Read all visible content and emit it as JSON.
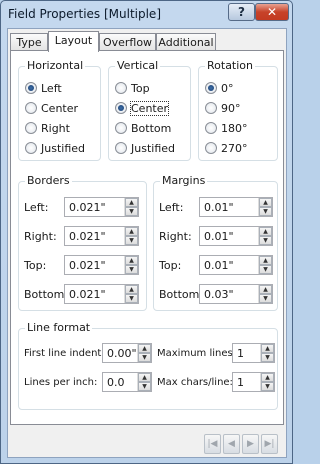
{
  "window": {
    "title": "Field Properties [Multiple]",
    "help_label": "?",
    "close_label": "✕"
  },
  "tabs": [
    {
      "label": "Type"
    },
    {
      "label": "Layout"
    },
    {
      "label": "Overflow"
    },
    {
      "label": "Additional"
    }
  ],
  "active_tab": "Layout",
  "horizontal": {
    "legend": "Horizontal",
    "options": [
      "Left",
      "Center",
      "Right",
      "Justified"
    ],
    "selected": "Left"
  },
  "vertical": {
    "legend": "Vertical",
    "options": [
      "Top",
      "Center",
      "Bottom",
      "Justified"
    ],
    "selected": "Center"
  },
  "rotation": {
    "legend": "Rotation",
    "options": [
      "0°",
      "90°",
      "180°",
      "270°"
    ],
    "selected": "0°"
  },
  "borders": {
    "legend": "Borders",
    "left_label": "Left:",
    "left_value": "0.021\"",
    "right_label": "Right:",
    "right_value": "0.021\"",
    "top_label": "Top:",
    "top_value": "0.021\"",
    "bottom_label": "Bottom:",
    "bottom_value": "0.021\""
  },
  "margins": {
    "legend": "Margins",
    "left_label": "Left:",
    "left_value": "0.01\"",
    "right_label": "Right:",
    "right_value": "0.01\"",
    "top_label": "Top:",
    "top_value": "0.01\"",
    "bottom_label": "Bottom:",
    "bottom_value": "0.03\""
  },
  "line_format": {
    "legend": "Line format",
    "first_indent_label": "First line indent:",
    "first_indent_value": "0.00\"",
    "max_lines_label": "Maximum lines:",
    "max_lines_value": "1",
    "lpi_label": "Lines per inch:",
    "lpi_value": "0.0",
    "max_chars_label": "Max chars/line:",
    "max_chars_value": "1"
  },
  "nav_icons": [
    "first-icon",
    "previous-icon",
    "next-icon",
    "last-icon"
  ]
}
